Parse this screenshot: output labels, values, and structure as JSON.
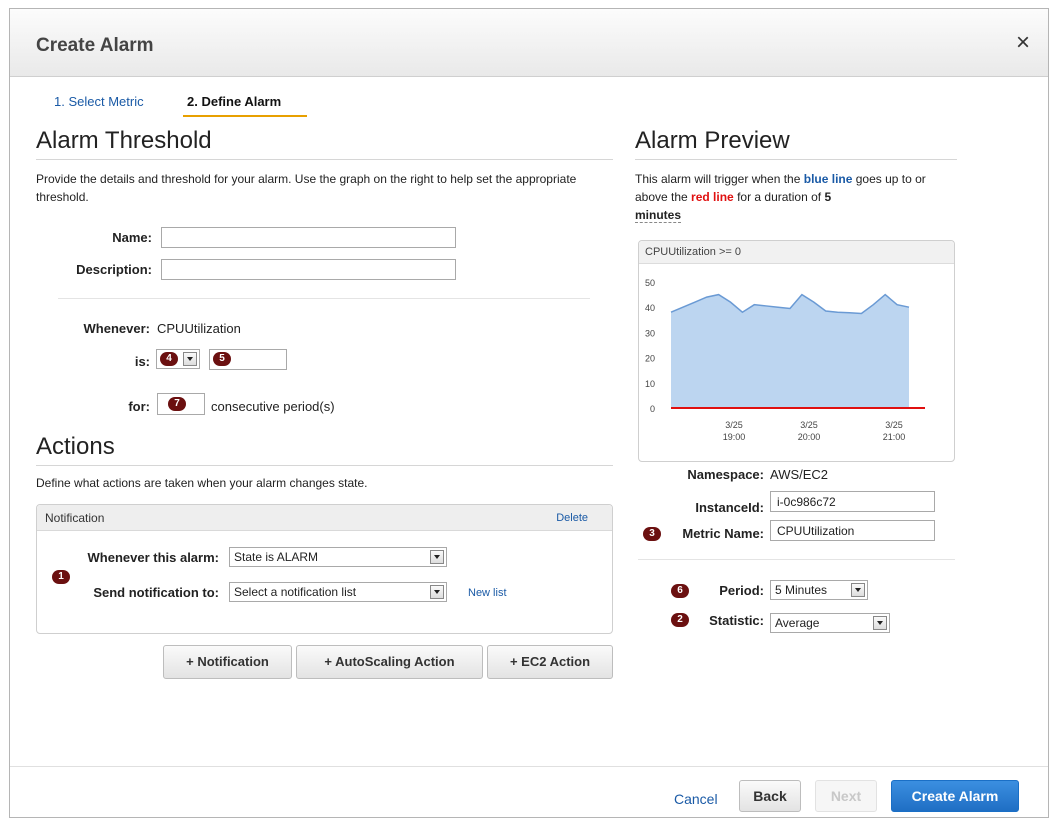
{
  "dialog": {
    "title": "Create Alarm",
    "close_glyph": "×"
  },
  "steps": [
    {
      "label": "1. Select Metric",
      "active": false
    },
    {
      "label": "2. Define Alarm",
      "active": true
    }
  ],
  "threshold": {
    "heading": "Alarm Threshold",
    "description": "Provide the details and threshold for your alarm. Use the graph on the right to help set the appropriate threshold.",
    "name_label": "Name:",
    "name_value": "",
    "description_label": "Description:",
    "description_value": "",
    "whenever_label": "Whenever:",
    "whenever_value": "CPUUtilization",
    "is_label": "is:",
    "badge_4": "4",
    "badge_5": "5",
    "for_label": "for:",
    "badge_7": "7",
    "consecutive_text": "consecutive period(s)"
  },
  "actions": {
    "heading": "Actions",
    "description": "Define what actions are taken when your alarm changes state.",
    "panel_title": "Notification",
    "delete_label": "Delete",
    "badge_1": "1",
    "whenever_alarm_label": "Whenever this alarm:",
    "whenever_alarm_value": "State is ALARM",
    "send_to_label": "Send notification to:",
    "send_to_value": "Select a notification list",
    "new_list_label": "New list",
    "buttons": {
      "notification": "+ Notification",
      "autoscaling": "+ AutoScaling Action",
      "ec2": "+ EC2 Action"
    }
  },
  "preview": {
    "heading": "Alarm Preview",
    "sentence_1": "This alarm will trigger when the ",
    "blue_line": "blue line",
    "sentence_2": " goes up to or above the ",
    "red_line": "red line",
    "sentence_3": " for a duration of ",
    "duration_number": "5",
    "duration_unit": "minutes",
    "namespace_label": "Namespace:",
    "namespace_value": "AWS/EC2",
    "instance_label": "InstanceId:",
    "instance_value": "i-0c986c72",
    "badge_3": "3",
    "metric_label": "Metric Name:",
    "metric_value": "CPUUtilization",
    "badge_6": "6",
    "period_label": "Period:",
    "period_value": "5 Minutes",
    "badge_2": "2",
    "statistic_label": "Statistic:",
    "statistic_value": "Average"
  },
  "chart_data": {
    "type": "area",
    "title": "CPUUtilization >= 0",
    "ylim": [
      0,
      50
    ],
    "yticks": [
      0,
      10,
      20,
      30,
      40,
      50
    ],
    "x_tick_labels": [
      {
        "date": "3/25",
        "time": "19:00"
      },
      {
        "date": "3/25",
        "time": "20:00"
      },
      {
        "date": "3/25",
        "time": "21:00"
      }
    ],
    "series": [
      {
        "values": [
          38,
          40,
          42,
          44,
          45,
          42,
          38,
          41,
          40.5,
          40,
          39.5,
          45,
          42,
          38.5,
          38,
          37.8,
          37.5,
          41,
          45,
          41,
          40
        ]
      }
    ],
    "threshold": 0,
    "colors": {
      "line": "#6a9ad4",
      "fill": "#bcd5f0",
      "threshold": "#e01010"
    },
    "grid": false
  },
  "footer": {
    "cancel_label": "Cancel",
    "back_label": "Back",
    "next_label": "Next",
    "create_label": "Create Alarm"
  }
}
